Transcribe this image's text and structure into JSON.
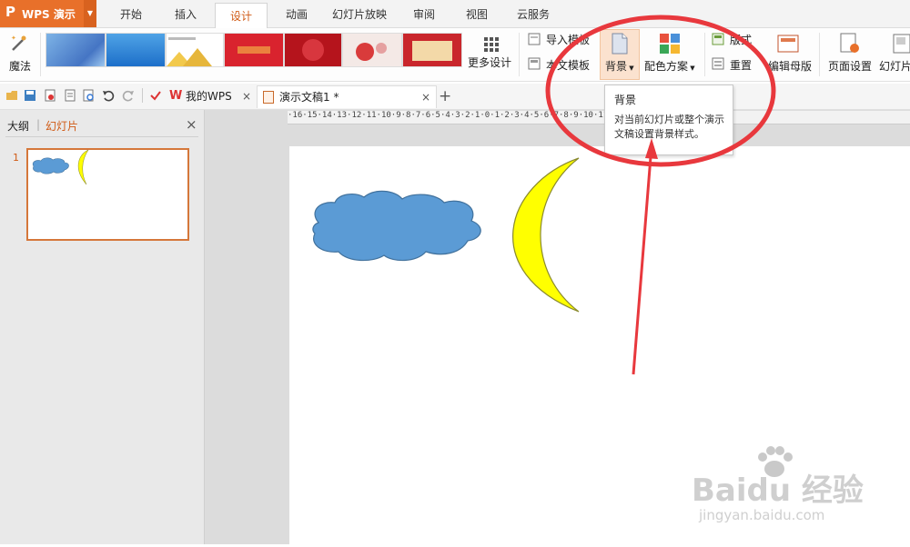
{
  "app": {
    "logo": "P",
    "name": "WPS 演示"
  },
  "menu": {
    "tabs": [
      "开始",
      "插入",
      "设计",
      "动画",
      "幻灯片放映",
      "审阅",
      "视图",
      "云服务"
    ],
    "active": "设计"
  },
  "ribbon": {
    "magic_label": "魔法",
    "more_designs_label": "更多设计",
    "import_template_label": "导入模板",
    "this_template_label": "本文模板",
    "background_label": "背景",
    "color_scheme_label": "配色方案",
    "layout_label": "版式",
    "reset_label": "重置",
    "edit_master_label": "编辑母版",
    "page_setup_label": "页面设置",
    "slide_size_label": "幻灯片"
  },
  "tooltip": {
    "title": "背景",
    "body": "对当前幻灯片或整个演示文稿设置背景样式。"
  },
  "doc_tabs": [
    {
      "label": "我的WPS",
      "close": "×"
    },
    {
      "label": "演示文稿1 *",
      "close": "×"
    }
  ],
  "new_tab": "+",
  "left_panel": {
    "outline_tab": "大纲",
    "slides_tab": "幻灯片",
    "close": "×",
    "slide_number": "1"
  },
  "ruler": {
    "text": "·16·15·14·13·12·11·10·9·8·7·6·5·4·3·2·1·0·1·2·3·4·5·6·7·8·9·10·11·12·13·14·15·16·"
  },
  "watermark": {
    "brand": "Baidu 经验",
    "url": "jingyan.baidu.com"
  },
  "colors": {
    "accent": "#e8702a",
    "cloud": "#5b9bd5",
    "moon": "#ffff00",
    "annotation": "#e8383d"
  }
}
